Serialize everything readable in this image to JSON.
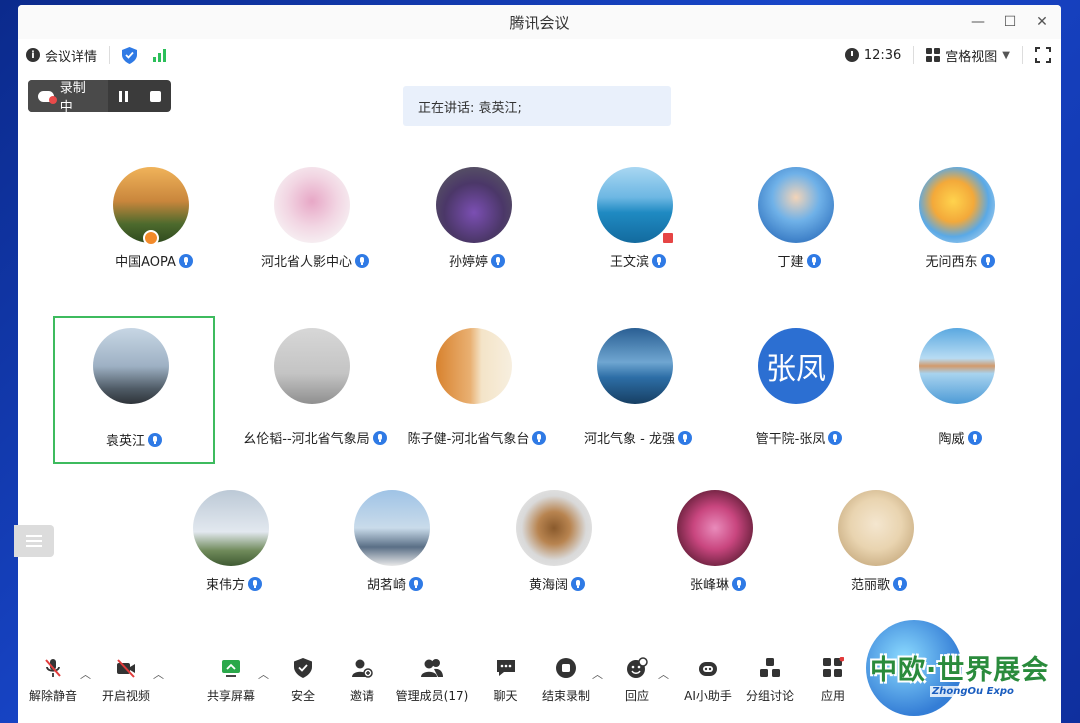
{
  "window": {
    "title": "腾讯会议"
  },
  "top_toolbar": {
    "meeting_details": "会议详情",
    "time": "12:36",
    "view_mode": "宫格视图"
  },
  "recording": {
    "label": "录制中"
  },
  "speaking": {
    "text": "正在讲话: 袁英江;"
  },
  "participants": [
    {
      "name": "中国AOPA"
    },
    {
      "name": "河北省人影中心"
    },
    {
      "name": "孙婷婷"
    },
    {
      "name": "王文滨"
    },
    {
      "name": "丁建"
    },
    {
      "name": "无问西东"
    },
    {
      "name": "袁英江"
    },
    {
      "name": "幺伦韬--河北省气象局"
    },
    {
      "name": "陈子健-河北省气象台"
    },
    {
      "name": "河北气象 - 龙强"
    },
    {
      "name": "管干院-张凤",
      "avatar_text": "张凤"
    },
    {
      "name": "陶威"
    },
    {
      "name": "束伟方"
    },
    {
      "name": "胡茗崎"
    },
    {
      "name": "黄海阔"
    },
    {
      "name": "张峰琳"
    },
    {
      "name": "范丽歌"
    }
  ],
  "bottom_toolbar": {
    "unmute": "解除静音",
    "start_video": "开启视频",
    "share_screen": "共享屏幕",
    "security": "安全",
    "invite": "邀请",
    "manage_members": "管理成员(17)",
    "chat": "聊天",
    "end_recording": "结束录制",
    "reactions": "回应",
    "ai_assistant": "AI小助手",
    "breakout": "分组讨论",
    "apps": "应用"
  },
  "watermark": {
    "text": "中欧·世界展会",
    "sub": "ZhongOu Expo"
  },
  "colors": {
    "accent": "#2f7ae5",
    "active_border": "#3dbb5e",
    "recording_bg": "#3b3b3b"
  }
}
